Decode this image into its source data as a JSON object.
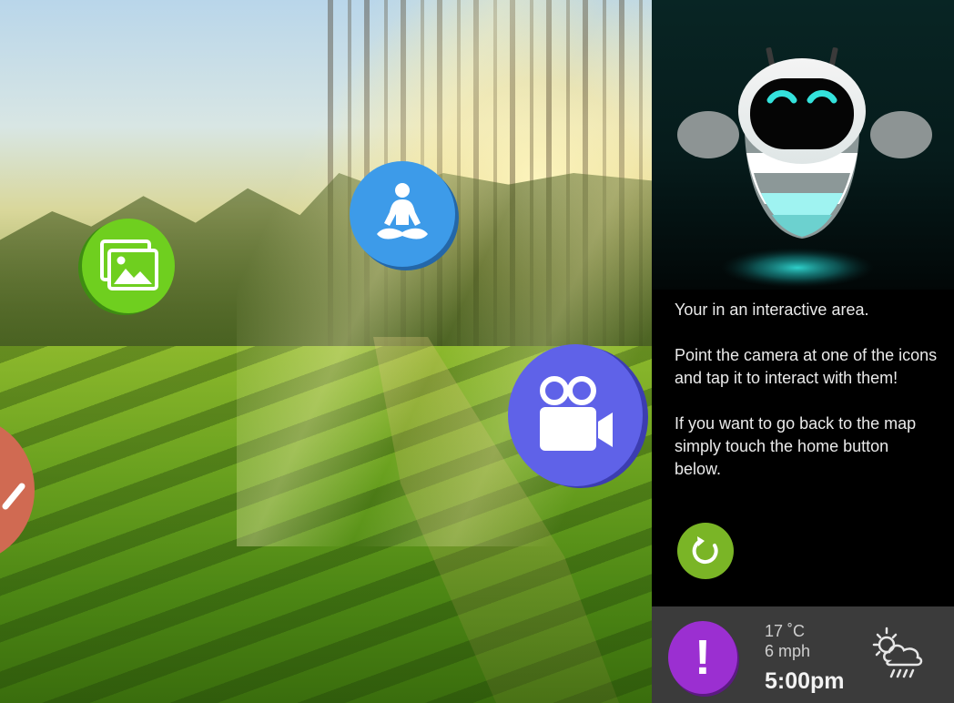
{
  "scene": {
    "icons": [
      {
        "name": "gallery",
        "icon": "image-gallery-icon",
        "color": "#6fcf1f"
      },
      {
        "name": "meditation",
        "icon": "yoga-icon",
        "color": "#3d9be9"
      },
      {
        "name": "video",
        "icon": "video-camera-icon",
        "color": "#5f62e8"
      },
      {
        "name": "partial",
        "icon": "check-icon",
        "color": "#d06a52"
      }
    ]
  },
  "assistant": {
    "message": {
      "line1": "Your in an interactive area.",
      "line2": "Point the camera at one of the icons and tap it to interact with them!",
      "line3": "If you want to go back to the map simply touch the home button below."
    },
    "home_button": {
      "icon": "refresh-home-icon",
      "color": "#7ab526"
    }
  },
  "footer": {
    "alert_symbol": "!",
    "alert_color": "#9b2fd1",
    "temperature": "17 ˚C",
    "wind": "6 mph",
    "time": "5:00pm",
    "weather_icon": "partly-cloudy-rain-icon"
  }
}
